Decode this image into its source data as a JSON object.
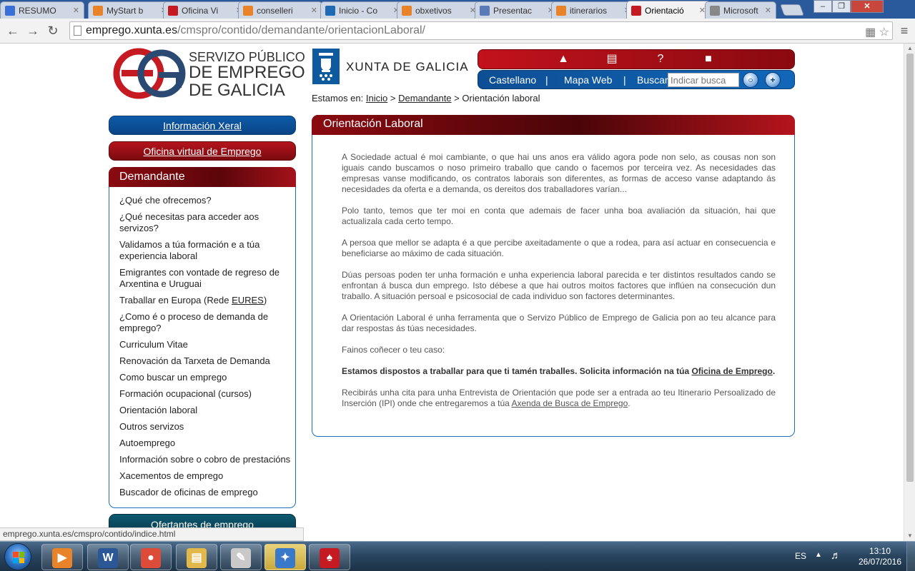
{
  "browser": {
    "tabs": [
      {
        "title": "RESUMO",
        "icon": "doc-icon",
        "color": "#3a6fd8"
      },
      {
        "title": "MyStart b",
        "icon": "search-icon",
        "color": "#e8832a"
      },
      {
        "title": "Oficina Vi",
        "icon": "eg-icon",
        "color": "#c51a22"
      },
      {
        "title": "conselleri",
        "icon": "search-icon",
        "color": "#e8832a"
      },
      {
        "title": "Inicio - Co",
        "icon": "page-icon",
        "color": "#1f6ab5"
      },
      {
        "title": "obxetivos",
        "icon": "search-icon",
        "color": "#e8832a"
      },
      {
        "title": "Presentac",
        "icon": "slides-icon",
        "color": "#5a7ab8"
      },
      {
        "title": "itinerarios",
        "icon": "search-icon",
        "color": "#e8832a"
      },
      {
        "title": "Orientació",
        "icon": "eg-icon",
        "color": "#c51a22"
      },
      {
        "title": "Microsoft",
        "icon": "page-icon",
        "color": "#888888"
      }
    ],
    "active_tab": 8,
    "url_host": "emprego.xunta.es",
    "url_path": "/cmspro/contido/demandante/orientacionLaboral/",
    "status_url": "emprego.xunta.es/cmspro/contido/indice.html"
  },
  "header": {
    "logo_lines": [
      "SERVIZO PÚBLICO",
      "DE EMPREGO",
      "DE GALICIA"
    ],
    "xunta_name": "XUNTA DE GALICIA",
    "util_icons": [
      "graduation-cap-icon",
      "shopping-cart-icon",
      "help-icon",
      "lock-icon"
    ],
    "lang_link": "Castellano",
    "map_link": "Mapa Web",
    "search_label": "Buscar",
    "search_placeholder": "Indicar busca",
    "separator": "|"
  },
  "breadcrumb": {
    "prefix": "Estamos en:",
    "items": [
      "Inicio",
      "Demandante"
    ],
    "current": "Orientación laboral",
    "sep": ">"
  },
  "sidebar": {
    "info_link": "Información Xeral",
    "office_link": "Oficina virtual de Emprego",
    "section_title": "Demandante",
    "items": [
      "¿Qué che ofrecemos?",
      "¿Qué necesitas para acceder aos servizos?",
      "Validamos a túa formación e a túa experiencia laboral",
      "Emigrantes con vontade de regreso de Arxentina e Uruguai",
      "Traballar en Europa (Rede ",
      "¿Como é o proceso de demanda de emprego?",
      "Curriculum Vitae",
      "Renovación da Tarxeta de Demanda",
      "Como buscar un emprego",
      "Formación ocupacional (cursos)",
      "Orientación laboral",
      "Outros servizos",
      "Autoemprego",
      "Información sobre o cobro de prestacións",
      "Xacementos de emprego",
      "Buscador de oficinas de emprego"
    ],
    "eures": "EURES",
    "eures_close": ")",
    "employers_title": "Ofertantes de emprego"
  },
  "content": {
    "title": "Orientación Laboral",
    "paragraphs": [
      "A Sociedade actual é moi cambiante, o que hai uns anos era válido agora pode non selo, as cousas non son iguais cando buscamos o noso primeiro traballo que cando o facemos por terceira vez. As necesidades das empresas vanse modificando, os contratos laborais son diferentes, as formas de acceso vanse adaptando ás necesidades da oferta e a demanda, os dereitos dos traballadores varían...",
      "Polo tanto, temos que ter moi en conta que ademais de facer unha boa avaliación da situación, hai que actualizala cada certo tempo.",
      "A persoa que mellor se adapta é a que percibe axeitadamente o que a rodea, para así actuar en consecuencia e beneficiarse ao máximo de cada situación.",
      "Dúas persoas poden ter unha formación e unha experiencia laboral parecida e ter distintos resultados cando se enfrontan á busca dun emprego. Isto débese a que hai outros moitos factores que inflúen na consecución dun traballo. A situación persoal e psicosocial de cada individuo son factores determinantes.",
      "A Orientación Laboral é unha ferramenta que o Servizo Público de Emprego de Galicia pon ao teu alcance para dar respostas ás túas necesidades.",
      "Fainos coñecer o teu caso:"
    ],
    "bold_text": "Estamos dispostos a traballar para que ti tamén traballes. Solicita información na túa ",
    "bold_link": "Oficina de Emprego",
    "bold_end": ".",
    "last_text": "Recibirás unha cita para unha Entrevista de Orientación que pode ser a entrada ao teu Itinerario Persoalizado de Inserción (IPI) onde che entregaremos a túa ",
    "last_link": "Axenda de Busca de Emprego",
    "last_end": "."
  },
  "taskbar": {
    "apps": [
      "media-player-icon",
      "word-icon",
      "chrome-icon",
      "file-explorer-icon",
      "paint-icon",
      "security-shield-icon",
      "pdf-reader-icon"
    ],
    "active_app": 5,
    "lang": "ES",
    "time": "13:10",
    "date": "26/07/2016"
  },
  "colors": {
    "brand_red": "#c2121c",
    "brand_blue": "#0d5ba8",
    "border_blue": "#1a6fb8"
  }
}
